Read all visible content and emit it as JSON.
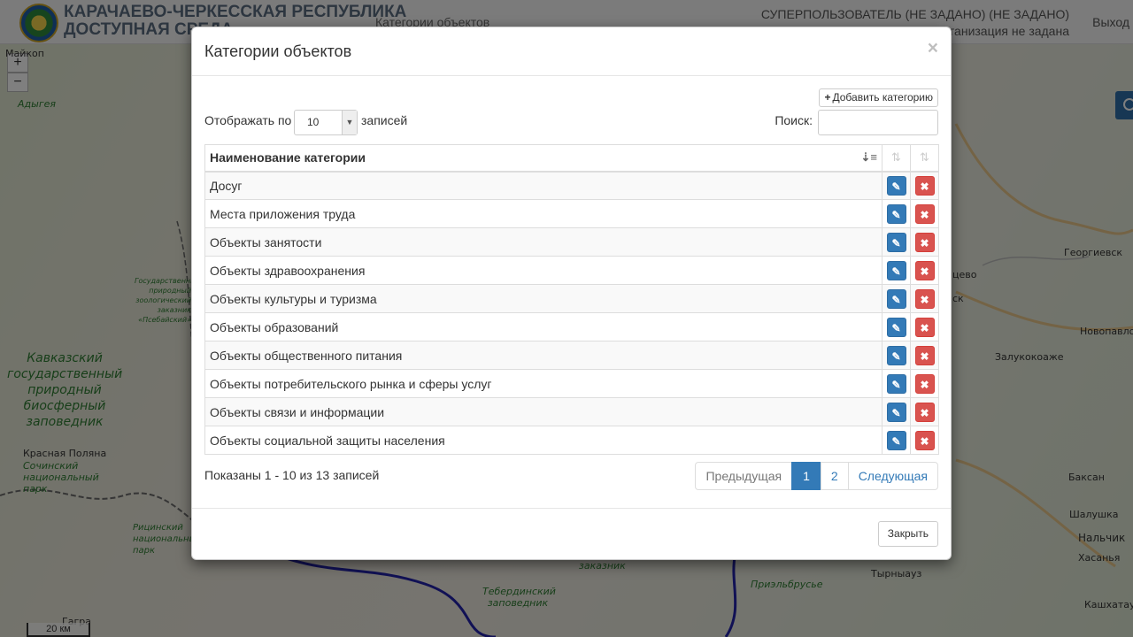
{
  "header": {
    "brand_line1": "КАРАЧАЕВО-ЧЕРКЕССКАЯ РЕСПУБЛИКА",
    "brand_line2": "ДОСТУПНАЯ СРЕДА",
    "nav_link": "Категории объектов",
    "user_name": "СУПЕРПОЛЬЗОВАТЕЛЬ (НЕ ЗАДАНО) (НЕ ЗАДАНО)",
    "user_org": "Организация не задана",
    "logout": "Выход"
  },
  "map": {
    "zoom_in": "+",
    "zoom_out": "−",
    "scale": "20 км",
    "labels": {
      "maikop": "Майкоп",
      "adygeya": "Адыгея",
      "reserve_small": "Государственный природный зоологический заказник «Псебайский»",
      "caucasus_reserve": "Кавказский государственный природный биосферный заповедник",
      "krasnaya_polyana": "Красная Поляна",
      "sochi_park": "Сочинский национальный парк",
      "ritsa_park": "Рицинский национальный парк",
      "gagra": "Гагра",
      "teberda": "Тебердинский заповедник",
      "zakaznik": "заказник",
      "priel": "Приэльбрусье",
      "tyrnyauz": "Тырныауз",
      "georgievsk": "Георгиевск",
      "novopavlovsk": "Новопавловск",
      "zalukokoazhe": "Залукокоаже",
      "baksan": "Баксан",
      "shalushka": "Шалушка",
      "nalchik": "Нальчик",
      "hasanya": "Хасанья",
      "kashkhatau": "Кашхатау",
      "partial_tsevo": "цево",
      "partial_sk": "ск"
    }
  },
  "modal": {
    "title": "Категории объектов",
    "close_symbol": "×",
    "add_button": "Добавить категорию",
    "length_prefix": "Отображать по",
    "length_value": "10",
    "length_suffix": "записей",
    "search_label": "Поиск:",
    "column_name": "Наименование категории",
    "rows": [
      "Досуг",
      "Места приложения труда",
      "Объекты занятости",
      "Объекты здравоохранения",
      "Объекты культуры и туризма",
      "Объекты образований",
      "Объекты общественного питания",
      "Объекты потребительского рынка и сферы услуг",
      "Объекты связи и информации",
      "Объекты социальной защиты населения"
    ],
    "info": "Показаны 1 - 10 из 13 записей",
    "pager": {
      "prev": "Предыдущая",
      "page1": "1",
      "page2": "2",
      "next": "Следующая"
    },
    "close_button": "Закрыть"
  },
  "colors": {
    "primary": "#337ab7",
    "danger": "#d9534f"
  }
}
